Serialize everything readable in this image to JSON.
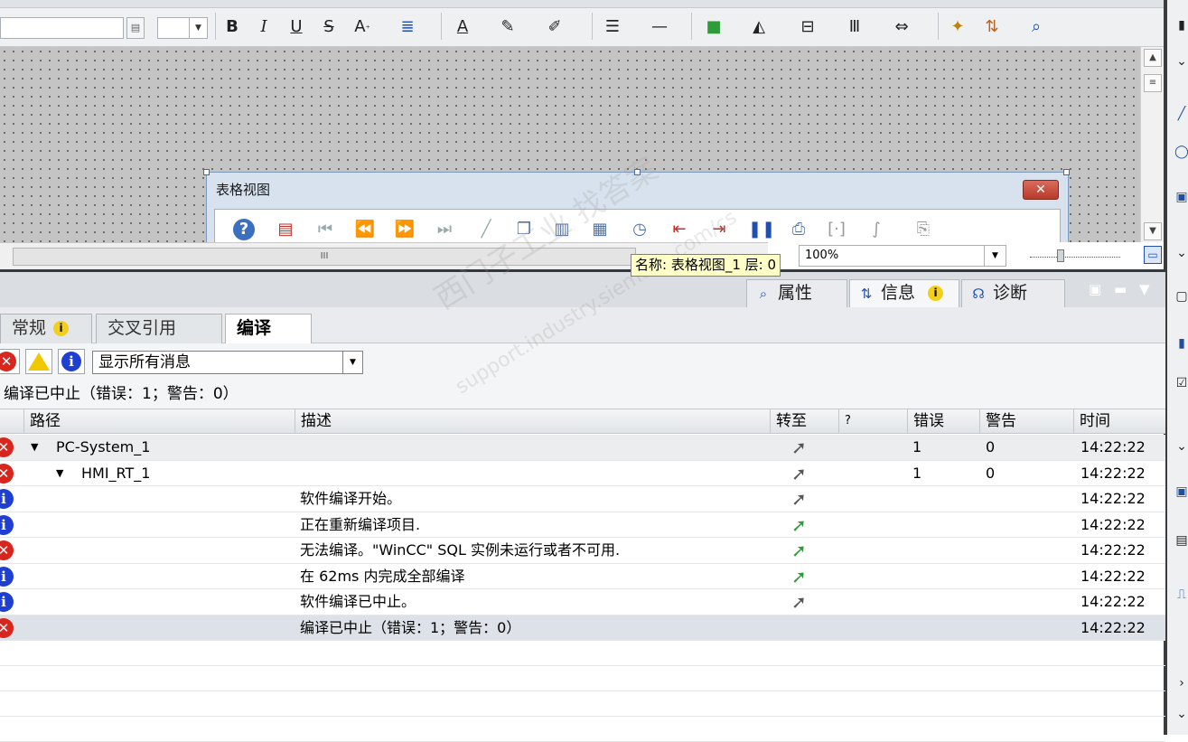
{
  "toolbar": {
    "icons": [
      "bold-icon",
      "italic-icon",
      "underline-icon",
      "strikethrough-icon",
      "font-size-icon",
      "align-icon",
      "font-color-icon",
      "fill-color-icon",
      "line-color-icon",
      "line-style-icon",
      "line-width-icon",
      "fill-pattern-icon",
      "rotate-icon",
      "align-objects-icon",
      "distribute-icon",
      "spacing-icon",
      "paint-icon",
      "layer-icon",
      "zoom-select-icon"
    ],
    "bold": "B",
    "italic": "I",
    "underline": "U",
    "strike": "S"
  },
  "canvas": {
    "object_title": "表格视图",
    "zoom": "100%",
    "tooltip": "名称: 表格视图_1  层: 0",
    "hscroll_grip": "III"
  },
  "panel": {
    "tabs": [
      {
        "label": "属性"
      },
      {
        "label": "信息"
      },
      {
        "label": "诊断"
      }
    ],
    "info_badge": "i"
  },
  "subtabs": [
    {
      "label": "常规"
    },
    {
      "label": "交叉引用"
    },
    {
      "label": "编译"
    }
  ],
  "filter": {
    "selected": "显示所有消息"
  },
  "status": "编译已中止（错误：1；警告：0）",
  "table": {
    "columns": [
      "路径",
      "描述",
      "转至",
      "?",
      "错误",
      "警告",
      "时间"
    ],
    "rows": [
      {
        "type": "error",
        "path": "PC-System_1",
        "desc": "",
        "goto": "grey",
        "err": "1",
        "warn": "0",
        "time": "14:22:22",
        "style": "grey"
      },
      {
        "type": "error",
        "path": "HMI_RT_1",
        "desc": "",
        "goto": "grey",
        "err": "1",
        "warn": "0",
        "time": "14:22:22",
        "style": "white"
      },
      {
        "type": "info",
        "path": "",
        "desc": "软件编译开始。",
        "goto": "grey",
        "err": "",
        "warn": "",
        "time": "14:22:22",
        "style": "white"
      },
      {
        "type": "info",
        "path": "",
        "desc": "正在重新编译项目.",
        "goto": "green",
        "err": "",
        "warn": "",
        "time": "14:22:22",
        "style": "white"
      },
      {
        "type": "error",
        "path": "",
        "desc": "无法编译。\"WinCC\" SQL 实例未运行或者不可用.",
        "goto": "green",
        "err": "",
        "warn": "",
        "time": "14:22:22",
        "style": "white"
      },
      {
        "type": "info",
        "path": "",
        "desc": "在 62ms 内完成全部编译",
        "goto": "green",
        "err": "",
        "warn": "",
        "time": "14:22:22",
        "style": "white"
      },
      {
        "type": "info",
        "path": "",
        "desc": "软件编译已中止。",
        "goto": "grey",
        "err": "",
        "warn": "",
        "time": "14:22:22",
        "style": "white"
      },
      {
        "type": "error",
        "path": "",
        "desc": "编译已中止（错误：1；警告：0）",
        "goto": "",
        "err": "",
        "warn": "",
        "time": "14:22:22",
        "style": "sel"
      }
    ]
  },
  "watermark": {
    "line1": "西门子工业  找答案",
    "line2": "support.industry.siemens.com/cs"
  },
  "colors": {
    "error": "#d7261e",
    "info": "#1f3fd0",
    "warning": "#f0c800",
    "goto_green": "#2f9c3a"
  }
}
